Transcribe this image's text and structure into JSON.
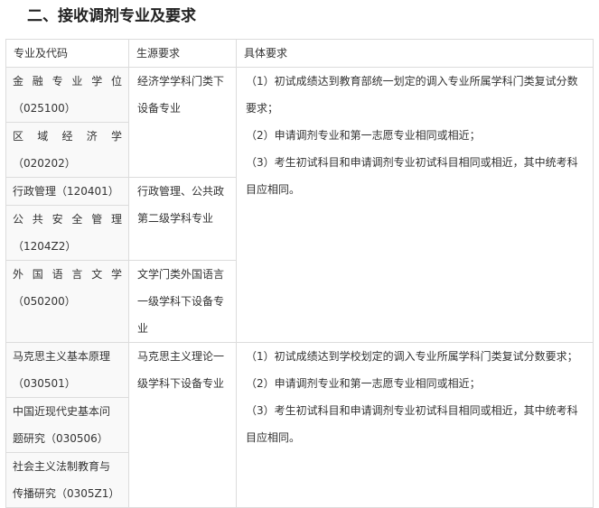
{
  "heading": "二、接收调剂专业及要求",
  "table": {
    "headers": [
      "专业及代码",
      "生源要求",
      "具体要求"
    ],
    "group1": {
      "majors": [
        {
          "name": "金 融 专 业 学 位",
          "code": "（025100）"
        },
        {
          "name": "区 域 经 济 学",
          "code": "（020202）"
        },
        {
          "name": "行政管理（120401）",
          "code": ""
        },
        {
          "name": "公 共 安 全 管 理",
          "code": "（1204Z2）"
        },
        {
          "name": "外 国 语 言 文 学",
          "code": "（050200）"
        }
      ],
      "sources": [
        {
          "line1": "经济学学科门类下",
          "line2": "设备专业"
        },
        {
          "line1": "行政管理、公共政",
          "line2": "第二级学科专业"
        },
        {
          "line1": "文学门类外国语言",
          "line2": "一级学科下设备专",
          "line3": "业"
        }
      ],
      "requirements": [
        "（1）初试成绩达到教育部统一划定的调入专业所属学科门类复试分数",
        "要求；",
        "（2）申请调剂专业和第一志愿专业相同或相近；",
        "（3）考生初试科目和申请调剂专业初试科目相同或相近，其中统考科",
        "目应相同。"
      ]
    },
    "group2": {
      "majors": [
        {
          "line1": "马克思主义基本原理",
          "line2": "（030501）"
        },
        {
          "line1": "中国近现代史基本问",
          "line2": "题研究（030506）"
        },
        {
          "line1": "社会主义法制教育与",
          "line2": "传播研究（0305Z1）"
        }
      ],
      "source": {
        "line1": "马克思主义理论一",
        "line2": "级学科下设备专业"
      },
      "requirements": [
        "（1）初试成绩达到学校划定的调入专业所属学科门类复试分数要求；",
        "（2）申请调剂专业和第一志愿专业相同或相近；",
        "（3）考生初试科目和申请调剂专业初试科目相同或相近，其中统考科",
        "目应相同。"
      ]
    }
  }
}
